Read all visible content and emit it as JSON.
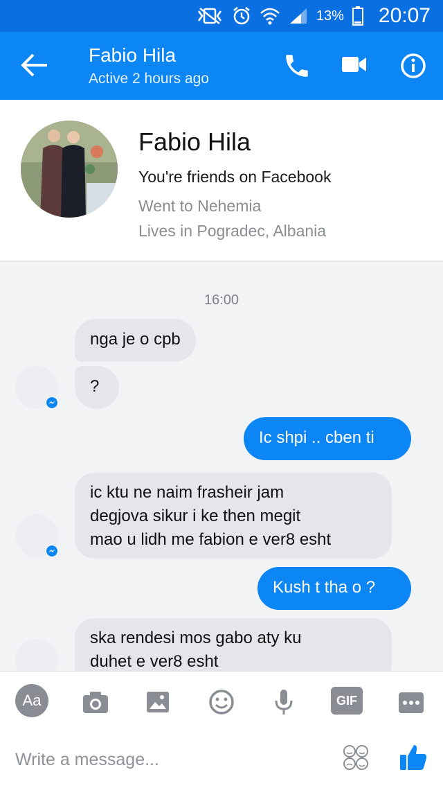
{
  "status_bar": {
    "battery_percent": "13%",
    "time": "20:07"
  },
  "header": {
    "contact_name": "Fabio Hila",
    "contact_status": "Active 2 hours ago"
  },
  "profile": {
    "name": "Fabio Hila",
    "line1": "You're friends on Facebook",
    "line2": "Went to Nehemia",
    "line3": "Lives in Pogradec, Albania"
  },
  "conversation": {
    "timestamp": "16:00",
    "messages": [
      {
        "from": "them",
        "text": "nga je o cpb"
      },
      {
        "from": "them",
        "text": "?"
      },
      {
        "from": "me",
        "text": "Ic shpi .. cben ti"
      },
      {
        "from": "them",
        "text": "ic ktu ne naim frasheir jam\ndegjova sikur i ke then megit\nmao u lidh me fabion e ver8 esht"
      },
      {
        "from": "me",
        "text": "Kush t tha o  ?"
      },
      {
        "from": "them",
        "text": "ska rendesi mos gabo aty ku\nduhet e ver8 esht"
      }
    ]
  },
  "composer": {
    "aa_label": "Aa",
    "gif_label": "GIF",
    "placeholder": "Write a message..."
  },
  "colors": {
    "brand_blue": "#0d86f5",
    "status_blue": "#0a6fe0",
    "incoming_bubble": "#e4e6eb"
  }
}
